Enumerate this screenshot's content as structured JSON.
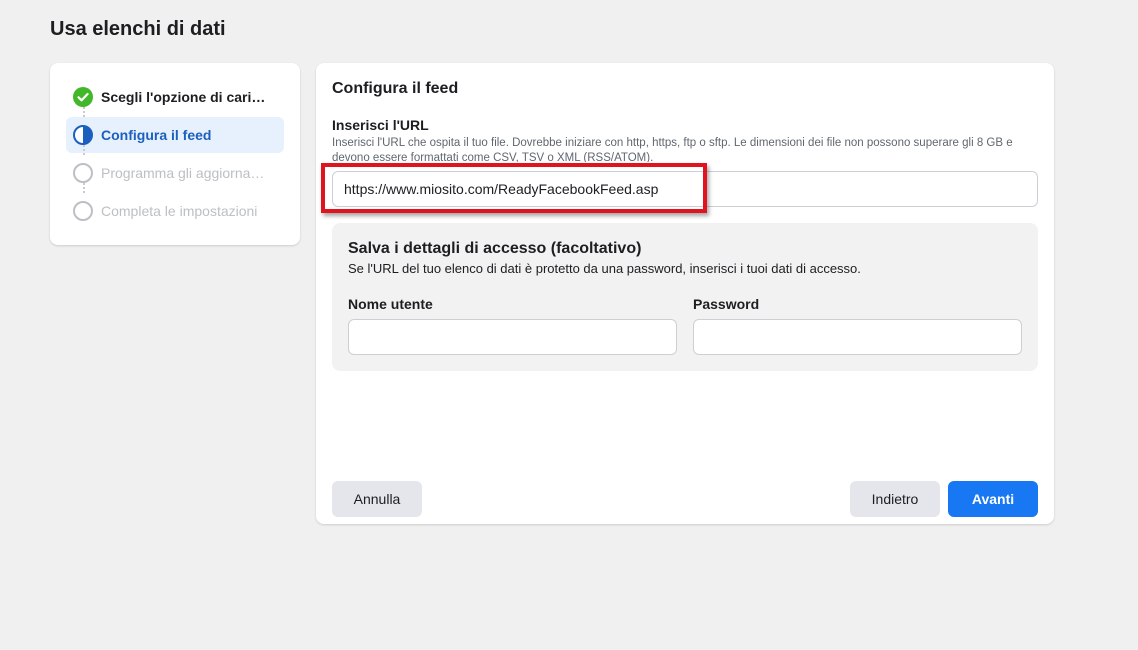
{
  "page": {
    "title": "Usa elenchi di dati"
  },
  "stepper": {
    "steps": [
      {
        "label": "Scegli l'opzione di caricamento",
        "status": "completed"
      },
      {
        "label": "Configura il feed",
        "status": "active"
      },
      {
        "label": "Programma gli aggiornamenti",
        "status": "pending"
      },
      {
        "label": "Completa le impostazioni",
        "status": "pending"
      }
    ]
  },
  "main": {
    "section_title": "Configura il feed",
    "url_label": "Inserisci l'URL",
    "url_help": "Inserisci l'URL che ospita il tuo file. Dovrebbe iniziare con http, https, ftp o sftp. Le dimensioni dei file non possono superare gli 8 GB e devono essere formattati come CSV, TSV o XML (RSS/ATOM).",
    "url_value": "https://www.miosito.com/ReadyFacebookFeed.asp",
    "access": {
      "title": "Salva i dettagli di accesso (facoltativo)",
      "description": "Se l'URL del tuo elenco di dati è protetto da una password, inserisci i tuoi dati di accesso.",
      "username_label": "Nome utente",
      "username_value": "",
      "password_label": "Password",
      "password_value": ""
    },
    "buttons": {
      "cancel": "Annulla",
      "back": "Indietro",
      "next": "Avanti"
    }
  },
  "colors": {
    "accent": "#1877f2",
    "success": "#42b72a",
    "highlight": "#e0141e",
    "active_step_bg": "#e7f0fd"
  }
}
